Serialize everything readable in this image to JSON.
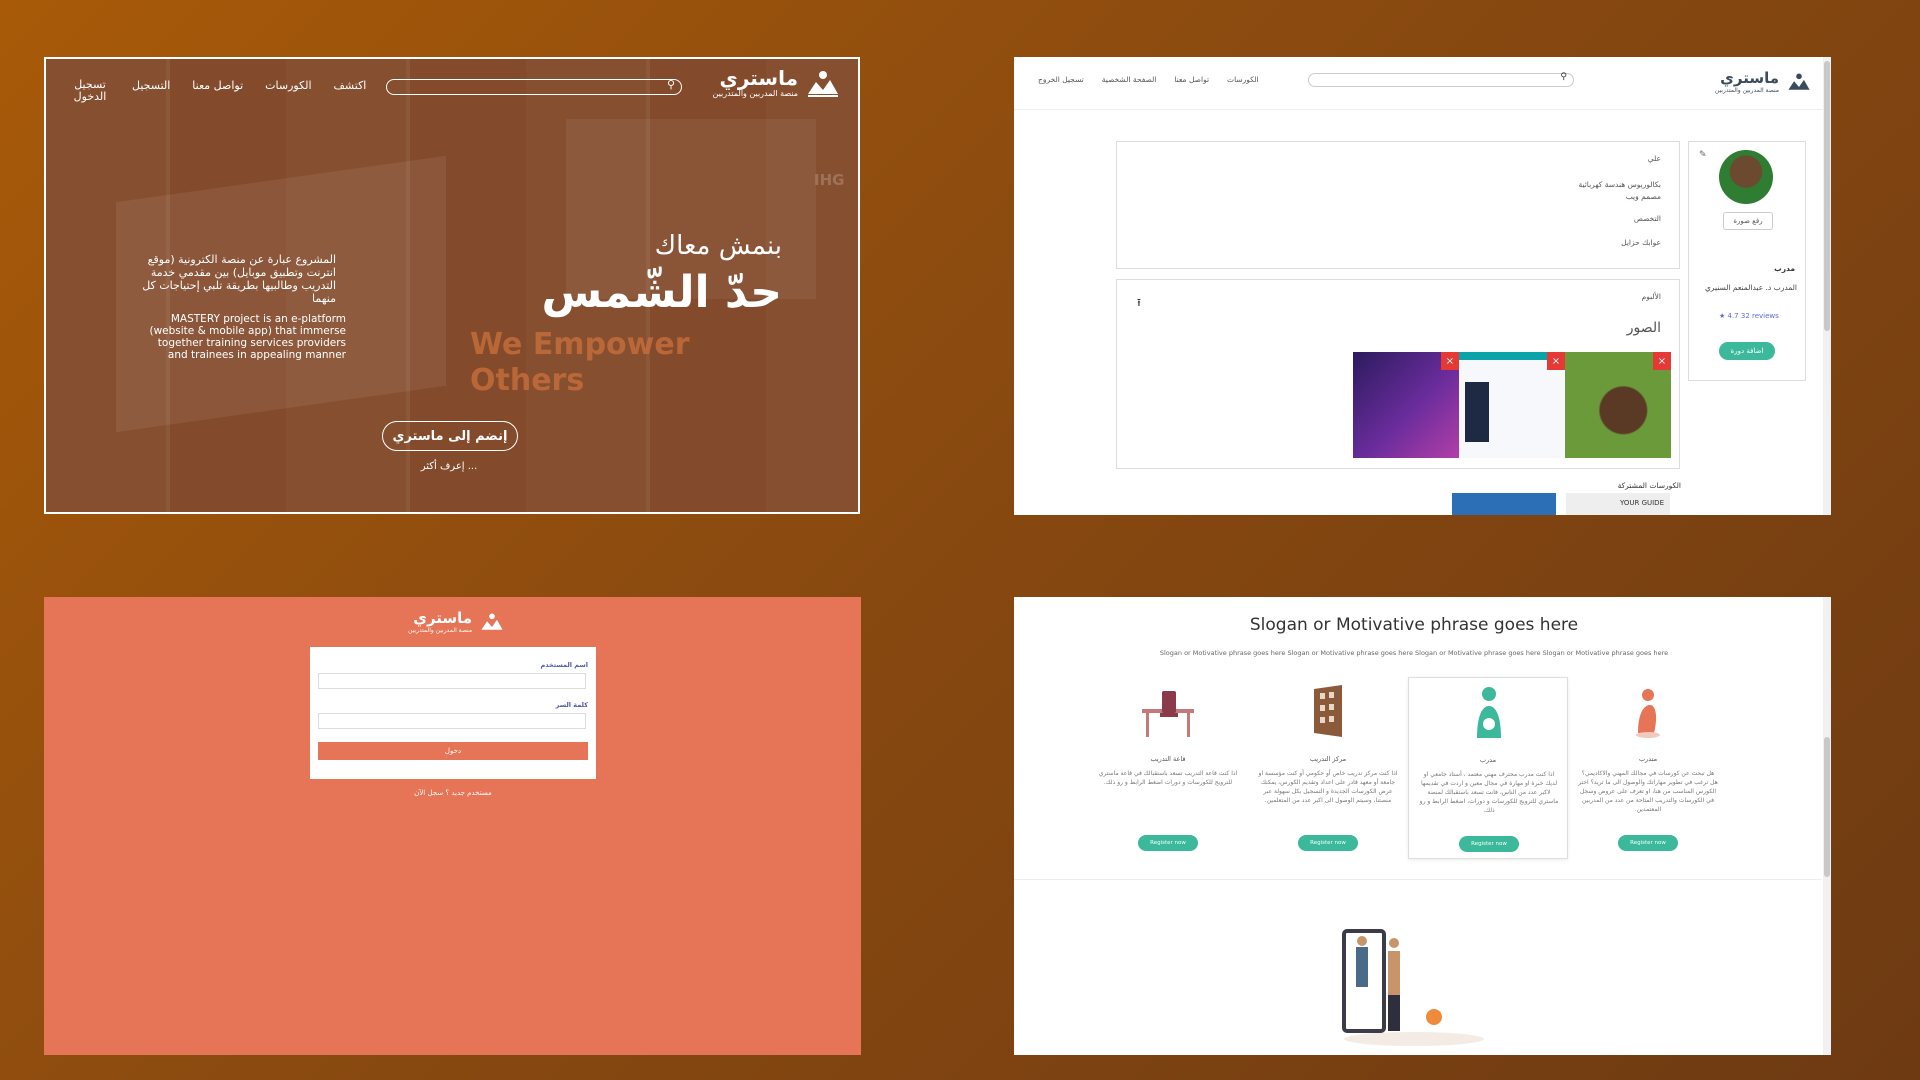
{
  "hero": {
    "logo_title": "ماستري",
    "logo_sub": "منصة المدربين والمتدربين",
    "nav": [
      "اكتشف",
      "الكورسات",
      "تواصل معنا",
      "التسجيل",
      "تسجيل الدخول"
    ],
    "heading_small": "بنمش معاك",
    "heading_big": "حدّ الشّمس",
    "desc_ar": "المشروع عبارة عن منصة الكترونية (موقع انترنت وتطبيق موبايل) بين مقدمي خدمة التدريب وطالبيها بطريقة تلبي إحتياجات كل منهما",
    "desc_en": "MASTERY project is an e-platform (website & mobile app) that immerse together training services providers and trainees in appealing manner",
    "bg_text_1": "We Empower",
    "bg_text_2": "Others",
    "bg_mark": "IHG",
    "cta": "إنضم إلى ماستري",
    "more": "إعرف أكثر ..."
  },
  "profile": {
    "logo_title": "ماستري",
    "logo_sub": "منصة المدربين والمتدربين",
    "nav": [
      "الكورسات",
      "تواصل معنا",
      "الصفحة الشخصية",
      "تسجيل الخروج"
    ],
    "info": [
      "علي",
      "بكالوريوس هندسة كهربائية",
      "مصمم ويب",
      "التخصص",
      "عوابك حزايل"
    ],
    "album_label": "الألبوم",
    "photos_label": "الصور",
    "close_glyph": "×",
    "upload_glyph": "⭱",
    "edit_glyph": "✎",
    "upload_photo_btn": "رفع صورة",
    "role": "مدرب",
    "trainer_name": "المدرب د. عبدالمنعم السنيري",
    "rating": "★ 4.7",
    "reviews": "32 reviews",
    "add_course_btn": "اضافة دورة",
    "courses_label": "الكورسات المشتركة",
    "course_tile_text": "YOUR GUIDE"
  },
  "login": {
    "logo_title": "ماستري",
    "logo_sub": "منصة المدربين والمتدربين",
    "username_label": "اسم المستخدم",
    "password_label": "كلمة السر",
    "submit": "دخول",
    "register_prompt": "مستخدم جديد ؟ سجل الآن"
  },
  "landing": {
    "title": "Slogan or Motivative phrase goes here",
    "subtitle": "Slogan or Motivative phrase goes here Slogan or Motivative phrase goes here Slogan or Motivative phrase goes here Slogan or Motivative phrase goes here",
    "columns": [
      {
        "title": "قاعة التدريب",
        "desc": "اذا كنت قاعة التدريب تسعد باستقبالك في قاعة ماستري للترويج للكورسات و دورات اضغط الرابط و رو ذلك.",
        "button": "Register now",
        "icon": "classroom-chair-icon"
      },
      {
        "title": "مركز التدريب",
        "desc": "اذا كنت مركز تدريب خاص أو حكومي أو كنت مؤسسة او جامعة أو معهد قادر على اعداد وتقديم الكورس، يمكنك عرض الكورسات الجديدة و التسجيل بكل سهولة عبر منصتنا، وسيتم الوصول الى اكبر عدد من المتعلمين.",
        "button": "Register now",
        "icon": "training-center-door-icon"
      },
      {
        "title": "مدرب",
        "desc": "اذا كنت مدرب محترف مهني معتمد ، أستاذ جامعي او لديك خبرة او مهارة في مجال معين و اردت في تقديمها لاكبر عدد من الناس، فانت تسعد باستقبالك لمنصة ماستري للترويج للكورسات و دورات، اضغط الرابط و رو ذلك.",
        "button": "Register now",
        "icon": "trainer-icon"
      },
      {
        "title": "متدرب",
        "desc": "هل تبحث عن كورسات في مجالك المهني والاكاديمي؟ هل ترغب في تطوير مهاراتك والوصول الى ما تريد؟ اختر الكورس المناسب من هنا، او تعرف على عروض وسجل في الكورسات والتدريب المتاحة من عدد من المدربين المعتمدين.",
        "button": "Register now",
        "icon": "trainee-icon"
      }
    ]
  },
  "colors": {
    "accent_green": "#3cb89a",
    "accent_coral": "#e67456",
    "close_red": "#e53935"
  }
}
